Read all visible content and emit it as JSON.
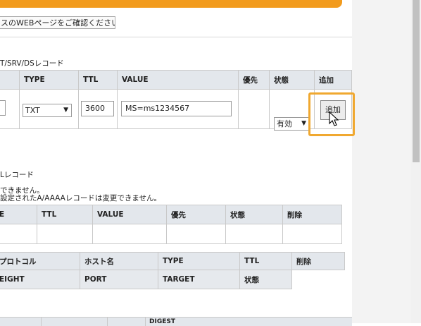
{
  "header": {
    "notice_button": "スのWEBページをご確認ください。"
  },
  "txt_section": {
    "title": "T/SRV/DSレコード",
    "headers": [
      "TYPE",
      "TTL",
      "VALUE",
      "優先",
      "状態",
      "追加"
    ],
    "type_value": "TXT",
    "ttl_value": "3600",
    "value_value": "MS=ms1234567",
    "status_value": "有効",
    "add_label": "追加"
  },
  "record_notes": {
    "title": "Lレコード",
    "line1": "できません。",
    "line2": "設定されたA/AAAAレコードは変更できません。"
  },
  "table2": {
    "headers": [
      "E",
      "TTL",
      "VALUE",
      "優先",
      "状態",
      "削除"
    ]
  },
  "srv_table": {
    "row1": [
      "プロトコル",
      "ホスト名",
      "TYPE",
      "TTL",
      "削除"
    ],
    "row2": [
      "EIGHT",
      "PORT",
      "TARGET",
      "状態"
    ]
  },
  "bottom_table": {
    "partial_header": "DIGEST"
  },
  "colors": {
    "accent_orange": "#f29b1d",
    "highlight": "#f0a830",
    "header_bg": "#e3e7ec"
  }
}
